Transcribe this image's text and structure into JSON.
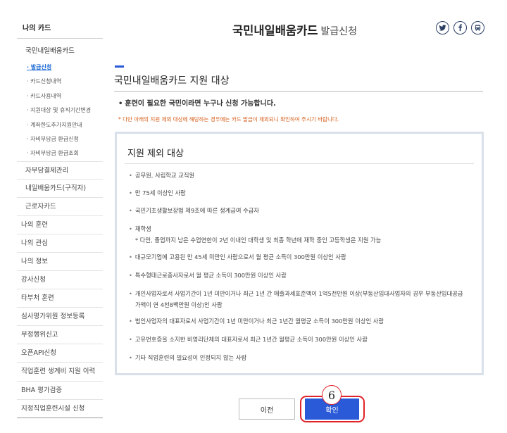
{
  "sidebar": {
    "top": "나의 카드",
    "sub": "국민내일배움카드",
    "children": [
      "· 발급신청",
      "· 카드신청내역",
      "· 카드사용내역",
      "· 지원대상 및 휴직기간변경",
      "· 계좌한도추가지원안내",
      "· 자비부담금 환급신청",
      "· 자비부담금 환급조회"
    ],
    "second": [
      "자부담결제관리",
      "내일배움카드(구직자)",
      "근로자카드"
    ],
    "main": [
      "나의 훈련",
      "나의 관심",
      "나의 정보",
      "강사신청",
      "타부처 훈련",
      "심사평가위원 정보등록",
      "부정행위신고",
      "오픈API신청",
      "직업훈련 생계비 지원 이력",
      "BHA 평가검증",
      "지정직업훈련시설 신청"
    ]
  },
  "header": {
    "title": "국민내일배움카드",
    "title_suffix": "발급신청"
  },
  "share": [
    {
      "name": "twitter-icon",
      "color": "#2b3f63"
    },
    {
      "name": "facebook-icon",
      "color": "#2b3f63"
    },
    {
      "name": "bus-icon",
      "color": "#2b3f63"
    }
  ],
  "section": {
    "title": "국민내일배움카드 지원 대상",
    "lead_bullet": "•",
    "lead": "훈련이 필요한 국민이라면 누구나 신청 가능합니다.",
    "notice": "* 다만 아래의 지원 제외 대상에 해당하는 경우에는 카드 발급이 제외되니 확인하여 주시기 바랍니다."
  },
  "exclusion": {
    "title": "지원 제외 대상",
    "items": [
      {
        "text": "공무원, 사립학교 교직원"
      },
      {
        "text": "만 75세 이상인 사람"
      },
      {
        "text": "국민기초생활보장법 제9조에 따른 생계급여 수급자"
      },
      {
        "text": "재학생",
        "sub": "* 다만, 졸업까지 남은 수업연한이 2년 이내인 대학생 및 최종 학년에 재학 중인 고등학생은 지원 가능"
      },
      {
        "text": "대규모기업에 고용된 만 45세 미만인 사람으로서 월 평균 소득이 300만원 이상인 사람"
      },
      {
        "text": "특수형태근로종사자로서 월 평균 소득이 300만원 이상인 사람"
      },
      {
        "text": "개인사업자로서 사업기간이 1년 미만이거나 최근 1년 간 매출과세표준액이 1억5천만원 이상(부동산임대사업자의 경우 부동산임대공급",
        "wrap": "가액이 연 4천8백만원 이상)인 사람"
      },
      {
        "text": "법인사업자의 대표자로서 사업기간이 1년 미만이거나 최근 1년간 월평균 소득이 300만원 이상인 사람"
      },
      {
        "text": "고유번호증을 소지한 비영리단체의 대표자로서 최근 1년간 월평균 소득이 300만원 이상인 사람"
      },
      {
        "text": "기타 직업훈련의 필요성이 인정되지 않는 사람"
      }
    ],
    "item_dot": "•"
  },
  "buttons": {
    "prev": "이전",
    "confirm": "확인"
  },
  "annotation": {
    "step": "6",
    "highlight_color": "#e0242b"
  }
}
